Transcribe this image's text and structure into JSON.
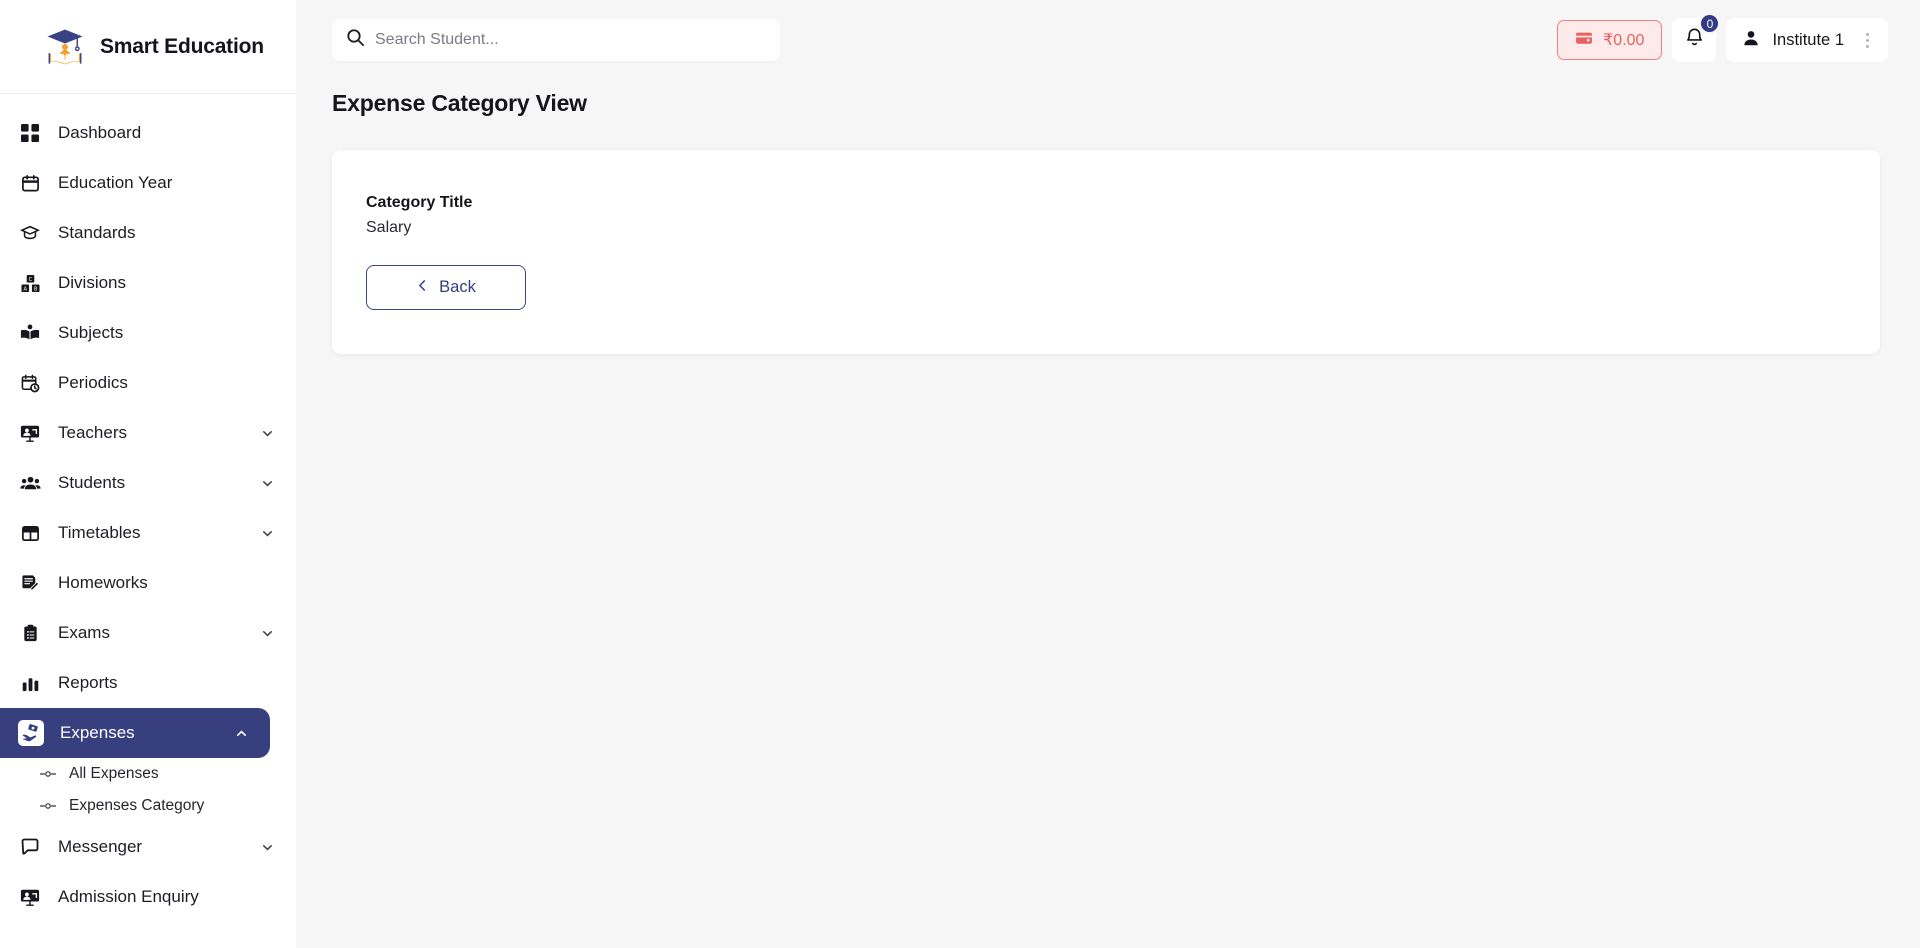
{
  "brand": {
    "name": "Smart Education"
  },
  "sidebar": {
    "items": [
      {
        "label": "Dashboard",
        "icon": "grid-icon",
        "expandable": false
      },
      {
        "label": "Education Year",
        "icon": "calendar-icon",
        "expandable": false
      },
      {
        "label": "Standards",
        "icon": "graduation-cap-icon",
        "expandable": false
      },
      {
        "label": "Divisions",
        "icon": "blocks-icon",
        "expandable": false
      },
      {
        "label": "Subjects",
        "icon": "open-book-icon",
        "expandable": false
      },
      {
        "label": "Periodics",
        "icon": "calendar-clock-icon",
        "expandable": false
      },
      {
        "label": "Teachers",
        "icon": "presentation-user-icon",
        "expandable": true
      },
      {
        "label": "Students",
        "icon": "users-icon",
        "expandable": true
      },
      {
        "label": "Timetables",
        "icon": "table-icon",
        "expandable": true
      },
      {
        "label": "Homeworks",
        "icon": "note-edit-icon",
        "expandable": false
      },
      {
        "label": "Exams",
        "icon": "clipboard-icon",
        "expandable": true
      },
      {
        "label": "Reports",
        "icon": "bar-chart-icon",
        "expandable": false
      },
      {
        "label": "Expenses",
        "icon": "money-hand-icon",
        "expandable": true,
        "active": true
      },
      {
        "label": "Messenger",
        "icon": "chat-icon",
        "expandable": true
      },
      {
        "label": "Admission Enquiry",
        "icon": "presentation-user-icon",
        "expandable": false
      }
    ],
    "expenses_submenu": [
      {
        "label": "All Expenses"
      },
      {
        "label": "Expenses Category"
      }
    ]
  },
  "topbar": {
    "search": {
      "placeholder": "Search Student...",
      "value": "",
      "icon": "search-icon"
    },
    "wallet": {
      "amount": "₹0.00",
      "icon": "wallet-icon"
    },
    "notifications": {
      "count": "0",
      "icon": "bell-icon"
    },
    "user": {
      "name": "Institute 1",
      "icon": "user-icon",
      "menu_icon": "kebab-menu-icon"
    }
  },
  "page": {
    "title": "Expense Category View",
    "card": {
      "field_label": "Category Title",
      "field_value": "Salary",
      "back_label": "Back",
      "back_icon": "chevron-left-icon"
    }
  },
  "colors": {
    "accent": "#383f7e",
    "danger": "#e8605e",
    "page_bg": "#f6f6f7",
    "card_bg": "#ffffff"
  }
}
